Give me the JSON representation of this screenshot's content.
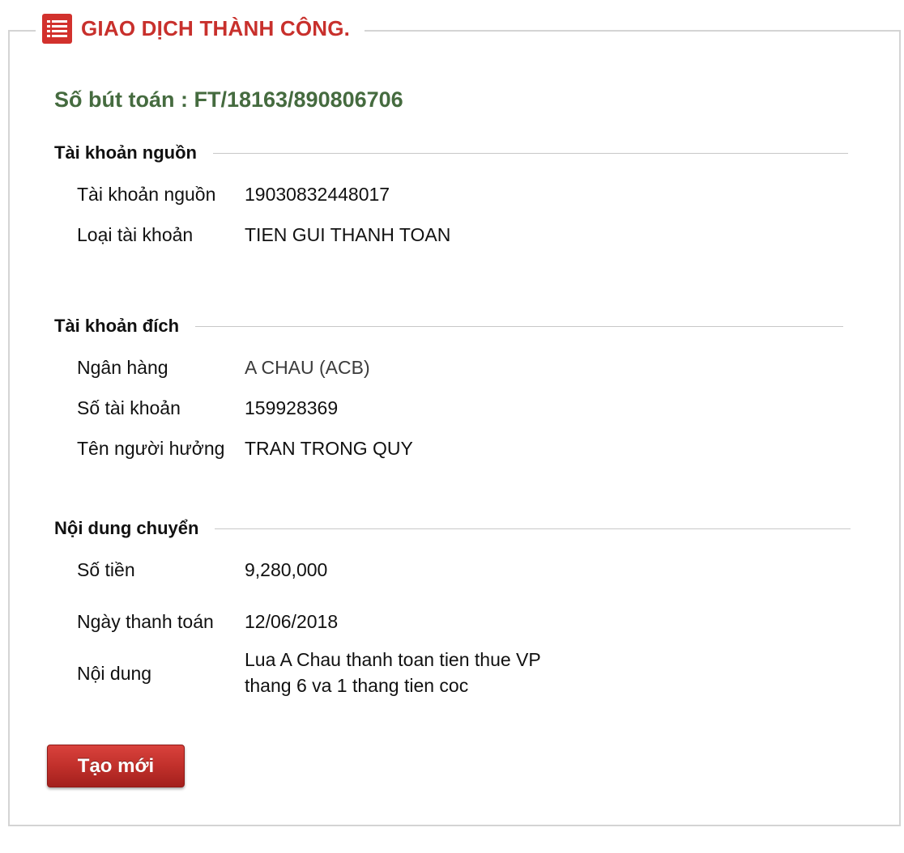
{
  "header": {
    "title": "GIAO DỊCH THÀNH CÔNG.",
    "icon": "list-icon",
    "accent_color": "#c8302c"
  },
  "reference": {
    "text": "Số bút toán : FT/18163/890806706",
    "color": "#456b3f"
  },
  "source_section": {
    "heading": "Tài khoản nguồn",
    "rows": [
      {
        "label": "Tài khoản nguồn",
        "value": "19030832448017"
      },
      {
        "label": "Loại tài khoản",
        "value": "TIEN GUI THANH TOAN"
      }
    ]
  },
  "dest_section": {
    "heading": "Tài khoản đích",
    "rows": [
      {
        "label": "Ngân hàng",
        "value": "A CHAU (ACB)"
      },
      {
        "label": "Số tài khoản",
        "value": "159928369"
      },
      {
        "label": "Tên người hưởng",
        "value": "TRAN TRONG QUY"
      }
    ]
  },
  "content_section": {
    "heading": "Nội dung chuyển",
    "rows": [
      {
        "label": "Số tiền",
        "value": "9,280,000"
      },
      {
        "label": "Ngày thanh toán",
        "value": "12/06/2018"
      },
      {
        "label": "Nội dung",
        "value_line1": "Lua A Chau thanh toan tien thue VP",
        "value_line2": "thang 6 va 1 thang tien coc"
      }
    ]
  },
  "actions": {
    "new_label": "Tạo mới"
  }
}
